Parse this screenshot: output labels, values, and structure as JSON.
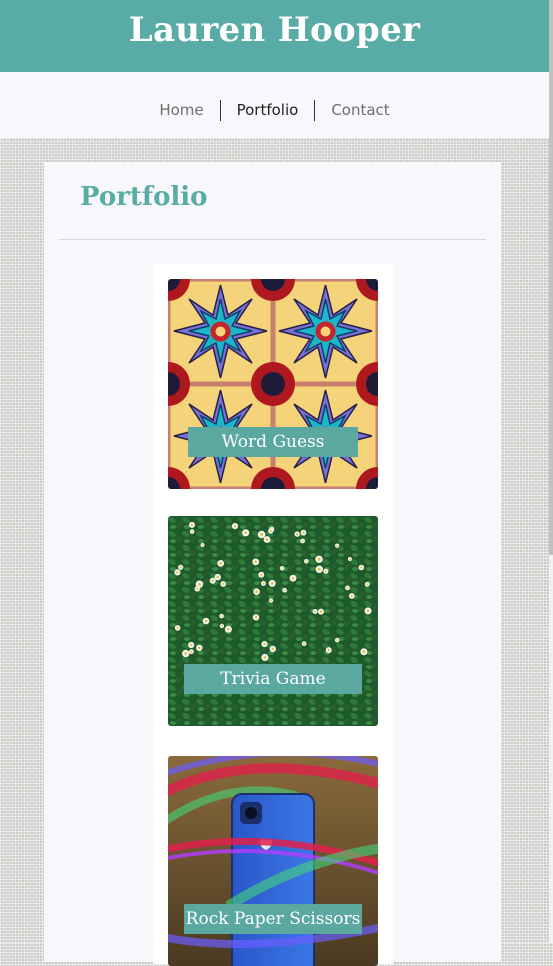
{
  "header": {
    "title": "Lauren Hooper",
    "bg_color": "#59aca6"
  },
  "nav": {
    "items": [
      {
        "label": "Home",
        "active": false
      },
      {
        "label": "Portfolio",
        "active": true
      },
      {
        "label": "Contact",
        "active": false
      }
    ]
  },
  "main": {
    "title": "Portfolio",
    "title_color": "#59aca6"
  },
  "projects": [
    {
      "label": "Word Guess",
      "image": "tile-pattern-image"
    },
    {
      "label": "Trivia Game",
      "image": "daisy-field-image"
    },
    {
      "label": "Rock Paper Scissors",
      "image": "phone-neon-image"
    }
  ]
}
